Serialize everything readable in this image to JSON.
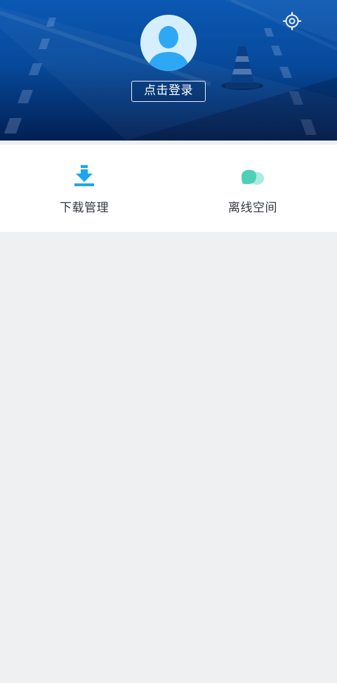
{
  "header": {
    "login_label": "点击登录",
    "settings_icon": "settings-gear-icon",
    "avatar_icon": "user-avatar-icon",
    "background_colors": [
      "#0b58b3",
      "#021f52"
    ]
  },
  "quick_actions": [
    {
      "label": "下载管理",
      "icon": "download-icon",
      "color": "#1aa7f0"
    },
    {
      "label": "离线空间",
      "icon": "cloud-icon",
      "color": "#4fd0b6"
    }
  ],
  "colors": {
    "page_background": "#eff0f2",
    "panel_background": "#ffffff",
    "text": "#333840"
  }
}
